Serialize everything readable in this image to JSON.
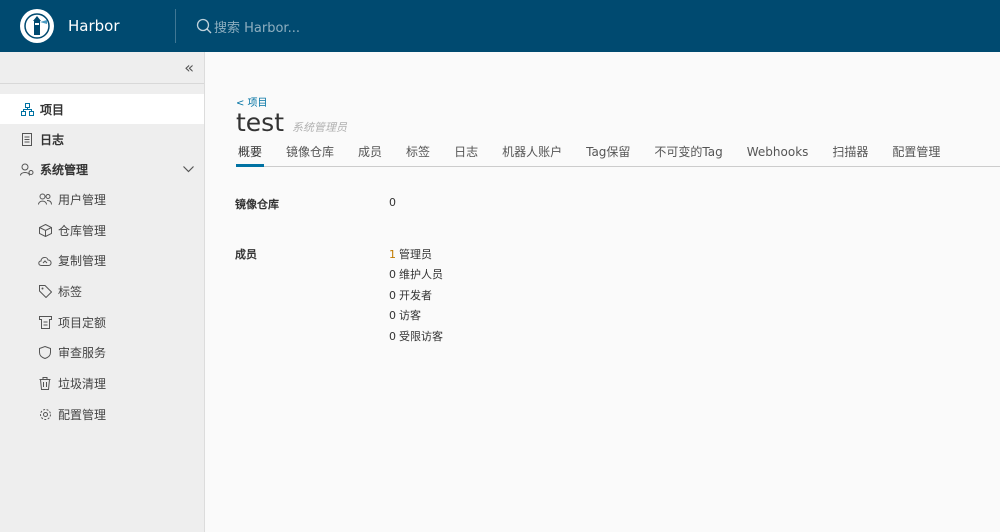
{
  "header": {
    "brand": "Harbor",
    "search_placeholder": "搜索 Harbor..."
  },
  "sidebar": {
    "collapse_icon": "double-chevron-left-icon",
    "items": [
      {
        "label": "项目",
        "icon": "projects-icon",
        "active": true
      },
      {
        "label": "日志",
        "icon": "logs-icon"
      },
      {
        "label": "系统管理",
        "icon": "admin-icon",
        "expanded": true
      }
    ],
    "sub_items": [
      {
        "label": "用户管理",
        "icon": "users-icon"
      },
      {
        "label": "仓库管理",
        "icon": "box-icon"
      },
      {
        "label": "复制管理",
        "icon": "cloud-icon"
      },
      {
        "label": "标签",
        "icon": "tag-icon"
      },
      {
        "label": "项目定额",
        "icon": "quota-icon"
      },
      {
        "label": "审查服务",
        "icon": "shield-icon"
      },
      {
        "label": "垃圾清理",
        "icon": "trash-icon"
      },
      {
        "label": "配置管理",
        "icon": "gear-icon"
      }
    ]
  },
  "main": {
    "breadcrumb": "< 项目",
    "title": "test",
    "role": "系统管理员",
    "tabs": [
      "概要",
      "镜像仓库",
      "成员",
      "标签",
      "日志",
      "机器人账户",
      "Tag保留",
      "不可变的Tag",
      "Webhooks",
      "扫描器",
      "配置管理"
    ],
    "repositories": {
      "label": "镜像仓库",
      "value": "0"
    },
    "members": {
      "label": "成员",
      "rows": [
        {
          "count": "1",
          "role": "管理员"
        },
        {
          "count": "0",
          "role": "维护人员"
        },
        {
          "count": "0",
          "role": "开发者"
        },
        {
          "count": "0",
          "role": "访客"
        },
        {
          "count": "0",
          "role": "受限访客"
        }
      ]
    }
  },
  "colors": {
    "header_bg": "#004a70",
    "accent": "#0072a3",
    "sidebar_bg": "#eeeeee"
  }
}
